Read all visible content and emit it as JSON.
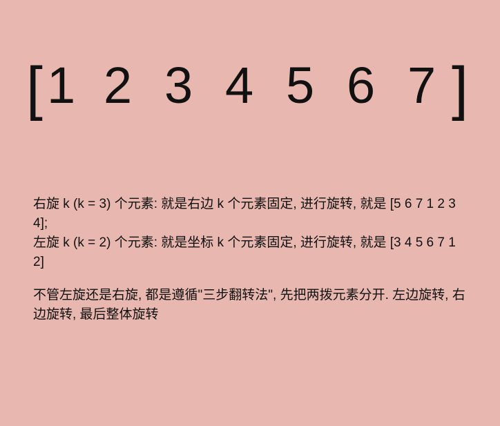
{
  "array": {
    "open_bracket": "[",
    "close_bracket": "]",
    "numbers": [
      "1",
      "2",
      "3",
      "4",
      "5",
      "6",
      "7"
    ]
  },
  "notes": {
    "para1": [
      "右旋 k (k = 3) 个元素: 就是右边 k 个元素固定, 进行旋转, 就是 [5 6 7 1 2 3 4];",
      "左旋 k (k = 2) 个元素: 就是坐标 k 个元素固定, 进行旋转, 就是 [3 4 5 6 7 1 2]"
    ],
    "para2": "不管左旋还是右旋, 都是遵循\"三步翻转法\", 先把两拨元素分开. 左边旋转, 右边旋转, 最后整体旋转"
  }
}
